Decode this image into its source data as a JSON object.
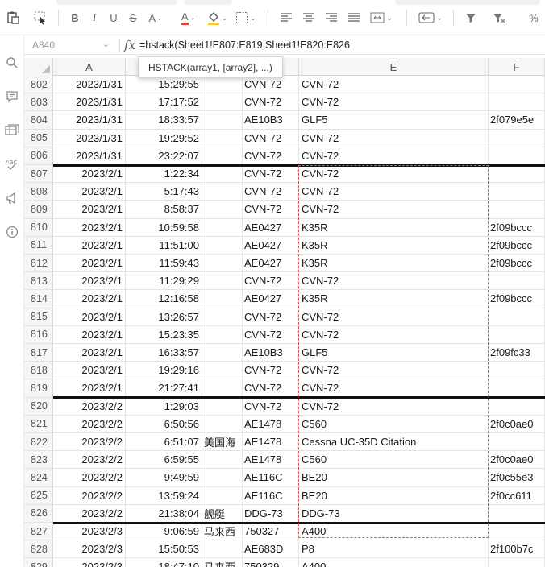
{
  "toolbar": {
    "paste_icon": "paste-icon",
    "format_painter_icon": "format-painter-icon",
    "bold_label": "B",
    "italic_label": "I",
    "underline_label": "U",
    "strike_label": "S",
    "font_size_label": "A",
    "font_color_label": "A",
    "accent_red": "#e0403a",
    "fill_accent": "#f4c542",
    "percent_label": "%"
  },
  "name_box": {
    "value": "A840"
  },
  "formula_bar": {
    "fx_label": "fx",
    "formula": "=hstack(Sheet1!E807:E819,Sheet1!E820:E826"
  },
  "tooltip": {
    "text": "HSTACK(array1, [array2], ...)"
  },
  "columns": [
    "A",
    "B",
    "C",
    "D",
    "E",
    "F"
  ],
  "column_headers_visible": [
    "A",
    "E",
    "F"
  ],
  "rows": [
    {
      "n": "802",
      "date": "2023/1/31",
      "time": "15:29:55",
      "c": "",
      "d": "CVN-72",
      "e": "CVN-72",
      "f": ""
    },
    {
      "n": "803",
      "date": "2023/1/31",
      "time": "17:17:52",
      "c": "",
      "d": "CVN-72",
      "e": "CVN-72",
      "f": ""
    },
    {
      "n": "804",
      "date": "2023/1/31",
      "time": "18:33:57",
      "c": "",
      "d": "AE10B3",
      "e": " GLF5",
      "f": "2f079e5e"
    },
    {
      "n": "805",
      "date": "2023/1/31",
      "time": "19:29:52",
      "c": "",
      "d": "CVN-72",
      "e": "CVN-72",
      "f": ""
    },
    {
      "n": "806",
      "date": "2023/1/31",
      "time": "23:22:07",
      "c": "",
      "d": "CVN-72",
      "e": "CVN-72",
      "f": ""
    },
    {
      "n": "807",
      "date": "2023/2/1",
      "time": "1:22:34",
      "c": "",
      "d": "CVN-72",
      "e": "CVN-72",
      "f": ""
    },
    {
      "n": "808",
      "date": "2023/2/1",
      "time": "5:17:43",
      "c": "",
      "d": "CVN-72",
      "e": "CVN-72",
      "f": ""
    },
    {
      "n": "809",
      "date": "2023/2/1",
      "time": "8:58:37",
      "c": "",
      "d": "CVN-72",
      "e": "CVN-72",
      "f": ""
    },
    {
      "n": "810",
      "date": "2023/2/1",
      "time": "10:59:58",
      "c": "",
      "d": "AE0427",
      "e": " K35R",
      "f": "2f09bccc"
    },
    {
      "n": "811",
      "date": "2023/2/1",
      "time": "11:51:00",
      "c": "",
      "d": "AE0427",
      "e": " K35R",
      "f": "2f09bccc"
    },
    {
      "n": "812",
      "date": "2023/2/1",
      "time": "11:59:43",
      "c": "",
      "d": "AE0427",
      "e": " K35R",
      "f": "2f09bccc"
    },
    {
      "n": "813",
      "date": "2023/2/1",
      "time": "11:29:29",
      "c": "",
      "d": "CVN-72",
      "e": "CVN-72",
      "f": ""
    },
    {
      "n": "814",
      "date": "2023/2/1",
      "time": "12:16:58",
      "c": "",
      "d": "AE0427",
      "e": " K35R",
      "f": "2f09bccc"
    },
    {
      "n": "815",
      "date": "2023/2/1",
      "time": "13:26:57",
      "c": "",
      "d": "CVN-72",
      "e": "CVN-72",
      "f": ""
    },
    {
      "n": "816",
      "date": "2023/2/1",
      "time": "15:23:35",
      "c": "",
      "d": "CVN-72",
      "e": "CVN-72",
      "f": ""
    },
    {
      "n": "817",
      "date": "2023/2/1",
      "time": "16:33:57",
      "c": "",
      "d": "AE10B3",
      "e": " GLF5",
      "f": "2f09fc33"
    },
    {
      "n": "818",
      "date": "2023/2/1",
      "time": "19:29:16",
      "c": "",
      "d": "CVN-72",
      "e": "CVN-72",
      "f": ""
    },
    {
      "n": "819",
      "date": "2023/2/1",
      "time": "21:27:41",
      "c": "",
      "d": "CVN-72",
      "e": "CVN-72",
      "f": ""
    },
    {
      "n": "820",
      "date": "2023/2/2",
      "time": "1:29:03",
      "c": "",
      "d": "CVN-72",
      "e": "CVN-72",
      "f": ""
    },
    {
      "n": "821",
      "date": "2023/2/2",
      "time": "6:50:56",
      "c": "",
      "d": "AE1478",
      "e": " C560",
      "f": "2f0c0ae0"
    },
    {
      "n": "822",
      "date": "2023/2/2",
      "time": "6:51:07",
      "c": "美国海",
      "d": "AE1478",
      "e": "Cessna UC-35D Citation",
      "f": ""
    },
    {
      "n": "823",
      "date": "2023/2/2",
      "time": "6:59:55",
      "c": "",
      "d": "AE1478",
      "e": " C560",
      "f": "2f0c0ae0"
    },
    {
      "n": "824",
      "date": "2023/2/2",
      "time": "9:49:59",
      "c": "",
      "d": "AE116C",
      "e": " BE20",
      "f": "2f0c55e3"
    },
    {
      "n": "825",
      "date": "2023/2/2",
      "time": "13:59:24",
      "c": "",
      "d": "AE116C",
      "e": " BE20",
      "f": "2f0cc611"
    },
    {
      "n": "826",
      "date": "2023/2/2",
      "time": "21:38:04",
      "c": "舰艇",
      "d": "DDG-73",
      "e": "DDG-73",
      "f": ""
    },
    {
      "n": "827",
      "date": "2023/2/3",
      "time": "9:06:59",
      "c": "马来西",
      "d": "750327",
      "e": "A400",
      "f": ""
    },
    {
      "n": "828",
      "date": "2023/2/3",
      "time": "15:50:53",
      "c": "",
      "d": "AE683D",
      "e": " P8",
      "f": "2f100b7c"
    },
    {
      "n": "829",
      "date": "2023/2/3",
      "time": "18:47:10",
      "c": "马来西",
      "d": "750329",
      "e": "A400",
      "f": ""
    }
  ],
  "selection": {
    "range_color": "#e05a5a"
  }
}
